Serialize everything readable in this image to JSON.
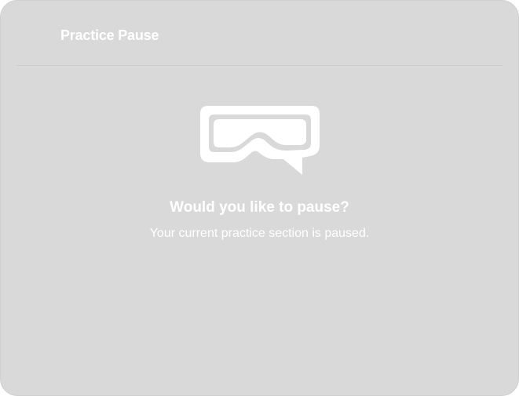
{
  "dialog": {
    "title": "Practice Pause",
    "headline": "Would you like to pause?",
    "message": "Your current practice section is paused.",
    "illustration_icon": "vr-headset-chat-icon"
  },
  "colors": {
    "background": "#d9d9d9",
    "text": "#ffffff",
    "divider": "#cdcdcd"
  }
}
